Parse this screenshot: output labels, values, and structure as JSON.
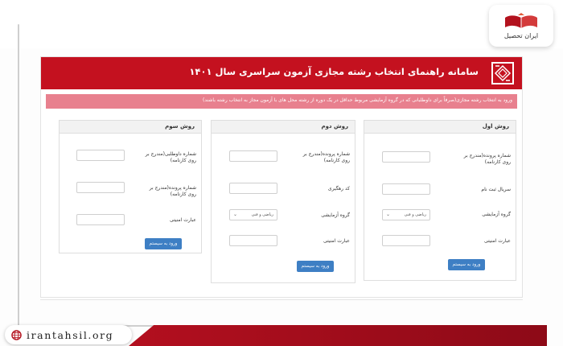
{
  "brand": {
    "name": "ایران تحصیل",
    "site": "irantahsil.org"
  },
  "header": {
    "title": "سامانه راهنمای انتخاب رشته مجازی آزمون سراسری سال ۱۴۰۱"
  },
  "notice": {
    "text": "ورود به انتخاب رشته مجازی(صرفاً برای داوطلبانی که در گروه آزمایشی مربوط حداقل در یک دوره از رشته محل های با آزمون مجاز به انتخاب رشته باشند)"
  },
  "methods": [
    {
      "title": "روش اول",
      "fields": [
        {
          "label": "شماره پرونده(مندرج بر روی کارنامه)"
        },
        {
          "label": "سریال ثبت نام"
        },
        {
          "label": "گروه آزمایشی",
          "selected": "ریاضی و فنی"
        },
        {
          "label": "عبارت امنیتی"
        }
      ],
      "button": "ورود به سیستم"
    },
    {
      "title": "روش دوم",
      "fields": [
        {
          "label": "شماره پرونده(مندرج بر روی کارنامه)"
        },
        {
          "label": "کد رهگیری"
        },
        {
          "label": "گروه آزمایشی",
          "selected": "ریاضی و فنی"
        },
        {
          "label": "عبارت امنیتی"
        }
      ],
      "button": "ورود به سیستم"
    },
    {
      "title": "روش سوم",
      "fields": [
        {
          "label": "شماره داوطلبی(مندرج بر روی کارنامه)"
        },
        {
          "label": "شماره پرونده(مندرج بر روی کارنامه)"
        },
        {
          "label": "عبارت امنیتی"
        }
      ],
      "button": "ورود به سیستم"
    }
  ],
  "colors": {
    "header": "#c4111f",
    "notice": "#e8808e",
    "button": "#3e7fc4"
  }
}
